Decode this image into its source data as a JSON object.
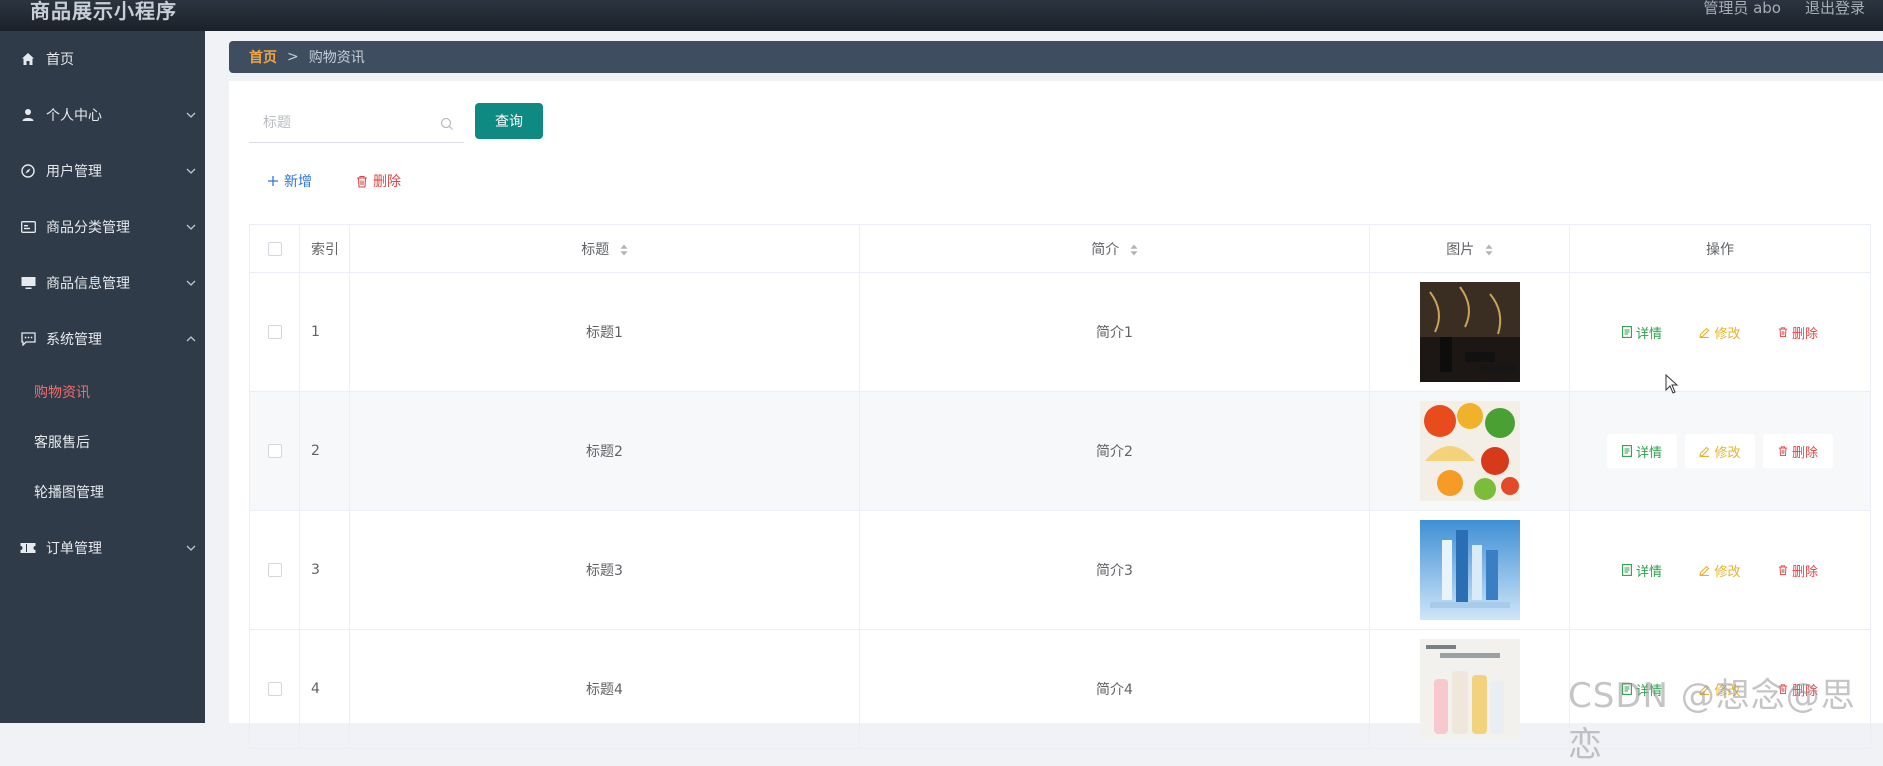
{
  "app": {
    "title": "商品展示小程序"
  },
  "header": {
    "admin_label": "管理员 abo",
    "logout_label": "退出登录"
  },
  "sidebar": {
    "items": [
      {
        "label": "首页",
        "icon": "home-icon",
        "has_arrow": false
      },
      {
        "label": "个人中心",
        "icon": "user-icon",
        "has_arrow": true
      },
      {
        "label": "用户管理",
        "icon": "compass-icon",
        "has_arrow": true
      },
      {
        "label": "商品分类管理",
        "icon": "id-card-icon",
        "has_arrow": true
      },
      {
        "label": "商品信息管理",
        "icon": "monitor-icon",
        "has_arrow": true
      },
      {
        "label": "系统管理",
        "icon": "chat-icon",
        "has_arrow": true,
        "expanded": true
      },
      {
        "label": "订单管理",
        "icon": "ticket-icon",
        "has_arrow": true
      }
    ],
    "sub_items": [
      {
        "label": "购物资讯",
        "active": true
      },
      {
        "label": "客服售后",
        "active": false
      },
      {
        "label": "轮播图管理",
        "active": false
      }
    ]
  },
  "breadcrumb": {
    "home": "首页",
    "separator": ">",
    "current": "购物资讯"
  },
  "search": {
    "placeholder": "标题",
    "value": "",
    "button_label": "查询"
  },
  "toolbar": {
    "add_label": "新增",
    "delete_label": "删除"
  },
  "table": {
    "headers": {
      "index": "索引",
      "title": "标题",
      "intro": "简介",
      "image": "图片",
      "actions": "操作"
    },
    "rows": [
      {
        "index": "1",
        "title": "标题1",
        "intro": "简介1",
        "image": "dark-cosmetics-photo"
      },
      {
        "index": "2",
        "title": "标题2",
        "intro": "简介2",
        "image": "fruit-photo"
      },
      {
        "index": "3",
        "title": "标题3",
        "intro": "简介3",
        "image": "blue-bottles-photo"
      },
      {
        "index": "4",
        "title": "标题4",
        "intro": "简介4",
        "image": "drink-bottles-photo"
      }
    ],
    "actions": {
      "detail": "详情",
      "edit": "修改",
      "delete": "删除"
    }
  },
  "watermark": "CSDN @想念@思恋",
  "colors": {
    "accent": "#0e8a83",
    "sidebar": "#2f3b48",
    "active_menu": "#f56c6c",
    "crumb_home": "#f0a640"
  }
}
